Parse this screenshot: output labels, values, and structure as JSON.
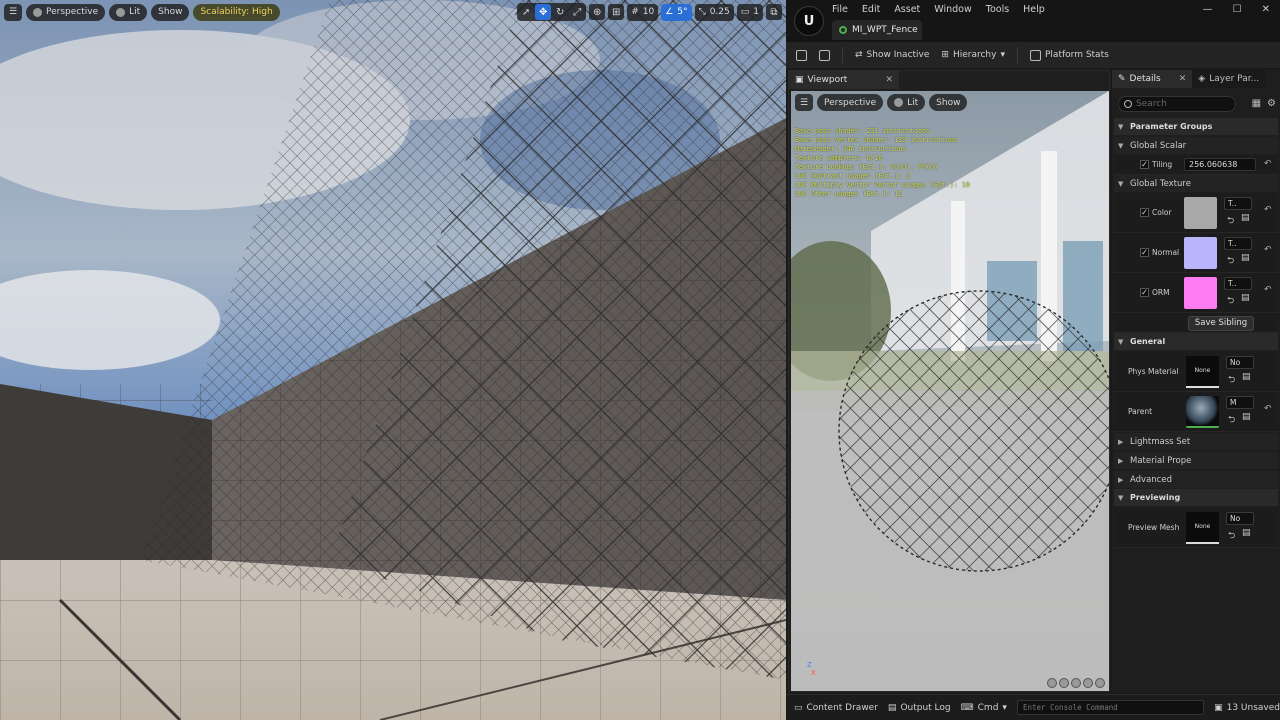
{
  "level_viewport": {
    "view_mode": "Perspective",
    "lighting": "Lit",
    "show": "Show",
    "scalability": "Scalability: High",
    "grid_snap": "10",
    "rotation_snap": "5°",
    "scale_snap": "0.25",
    "camera_speed": "1"
  },
  "editor": {
    "logo": "U",
    "menu": [
      "File",
      "Edit",
      "Asset",
      "Window",
      "Tools",
      "Help"
    ],
    "asset_tab": "MI_WPT_Fence",
    "window_controls": [
      "—",
      "☐",
      "✕"
    ],
    "toolbar": {
      "show_inactive": "Show Inactive",
      "hierarchy": "Hierarchy",
      "platform_stats": "Platform Stats"
    }
  },
  "viewport_panel": {
    "tab": "Viewport",
    "view_mode": "Perspective",
    "lighting": "Lit",
    "show": "Show",
    "stats": [
      "Base pass shader: 231 instructions",
      "Base pass vertex shader: 129 instructions",
      "Mateshader: 346 instructions",
      "Texture samplers: 6/16",
      "Texture Lookups (Est.): VS(0), PS(6)",
      "LWC Subtract usages (Est.): 2",
      "LWC Multiply Vector Vector usages (Est.): 10",
      "LWC Other usages (Est.): 12"
    ],
    "axis_z": "Z",
    "axis_x": "X"
  },
  "details": {
    "tabs": [
      "Details",
      "Layer Par..."
    ],
    "search_placeholder": "Search",
    "parameter_groups": "Parameter Groups",
    "global_scalar": "Global Scalar",
    "tiling_label": "Tiling",
    "tiling_value": "256.060638",
    "global_texture": "Global Texture",
    "color_label": "Color",
    "normal_label": "Normal",
    "orm_label": "ORM",
    "tex_dropdown": "T..",
    "save_sibling": "Save Sibling",
    "general": "General",
    "phys_material_label": "Phys Material",
    "phys_material_value": "None",
    "phys_dropdown": "No",
    "parent_label": "Parent",
    "parent_dropdown": "M",
    "lightmass": "Lightmass Set",
    "material_props": "Material Prope",
    "advanced": "Advanced",
    "previewing": "Previewing",
    "preview_mesh_label": "Preview Mesh",
    "preview_mesh_value": "None",
    "preview_dropdown": "No",
    "colors": {
      "color_swatch": "#a8a8a8",
      "normal_swatch": "#b9b4fb",
      "orm_swatch": "#ff7cf0"
    }
  },
  "bottom_bar": {
    "content_drawer": "Content Drawer",
    "output_log": "Output Log",
    "cmd": "Cmd",
    "console_placeholder": "Enter Console Command",
    "unsaved": "13 Unsaved"
  }
}
